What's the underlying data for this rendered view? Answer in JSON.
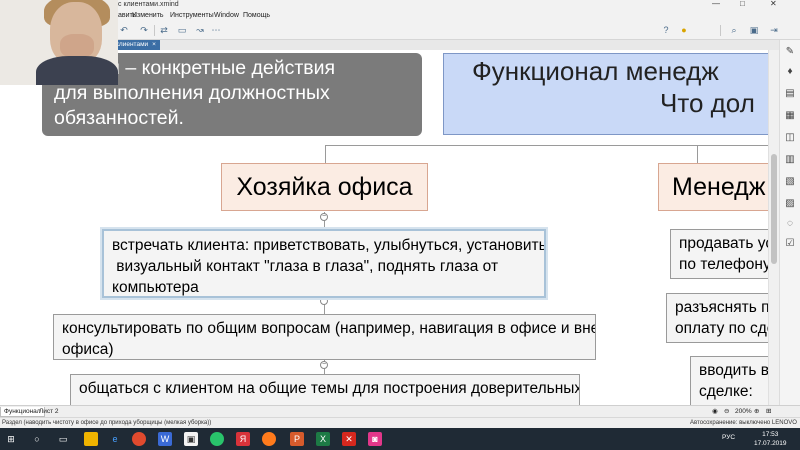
{
  "window": {
    "title_fragment": "с клиентами.xmind",
    "controls": {
      "minimize": "—",
      "maximize": "□",
      "close": "✕"
    }
  },
  "menu": {
    "items": [
      "авить",
      "Изменить",
      "Инструменты",
      "Window",
      "Помощь"
    ]
  },
  "tab": {
    "label": "клиентами",
    "close": "×"
  },
  "toolbar": {
    "icons": [
      "undo-icon",
      "redo-icon",
      "connect-icon",
      "topic-icon",
      "relationship-icon",
      "more-icon",
      "help-icon",
      "lightbulb-icon",
      "search-icon",
      "layout-icon",
      "export-icon"
    ]
  },
  "mindmap": {
    "definition_lines": [
      "ционал – конкретные действия",
      "для выполнения должностных",
      "обязанностей."
    ],
    "main_title_lines": [
      "Функционал менедж",
      "Что дол"
    ],
    "branch_left": "Хозяйка офиса",
    "branch_right": "Менедж",
    "left_tasks": [
      {
        "lines": [
          "встречать клиента: приветствовать, улыбнуться, установить",
          " визуальный контакт \"глаза в глаза\", поднять глаза от",
          "компьютера"
        ]
      },
      {
        "lines": [
          "консультировать по общим вопросам (например, навигация в офисе и вне",
          "офиса)"
        ]
      },
      {
        "lines": [
          "общаться с клиентом на общие темы для построения доверительных"
        ]
      }
    ],
    "right_tasks": [
      {
        "lines": [
          "продавать ус",
          "по телефону"
        ]
      },
      {
        "lines": [
          "разъяснять п",
          "оплату по сде"
        ]
      },
      {
        "lines": [
          "вводить в",
          "сделке:"
        ]
      }
    ],
    "collapse_symbol": "−"
  },
  "sheets": {
    "items": [
      "Функционал",
      "Лист 2"
    ],
    "zoom": "200%"
  },
  "status": {
    "left": "Раздел (наводить чистоту в офисе до прихода уборщицы (мелкая уборка))",
    "right": "Автосохранение: выключено   LENOVO"
  },
  "taskbar": {
    "lang": "РУС",
    "time": "17:53",
    "date": "17.07.2019"
  }
}
